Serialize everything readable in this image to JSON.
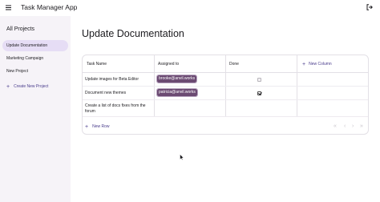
{
  "app": {
    "title": "Task Manager App",
    "menu_icon": "hamburger-menu-icon",
    "logout_icon": "logout-icon"
  },
  "sidebar": {
    "heading": "All Projects",
    "items": [
      {
        "label": "Update Documentation",
        "active": true
      },
      {
        "label": "Marketing Campaign",
        "active": false
      },
      {
        "label": "New Project",
        "active": false
      }
    ],
    "create_label": "Create New Project"
  },
  "main": {
    "title": "Update Documentation",
    "table": {
      "columns": [
        "Task Name",
        "Assigned to",
        "Done"
      ],
      "add_column_label": "New Column",
      "rows": [
        {
          "task": "Update images for Beta Editor",
          "assignee": "brooke@anvil.works",
          "done": false
        },
        {
          "task": "Document new themes",
          "assignee": "patricia@anvil.works",
          "done": true
        },
        {
          "task": "Create a list of docs fixes from the forum",
          "assignee": "",
          "done": false
        }
      ],
      "new_row_label": "New Row"
    }
  },
  "colors": {
    "accent": "#4a3c8c",
    "chip": "#6b4a72",
    "active_nav": "#e6ddf5",
    "sidebar_bg": "#f6f3f8"
  }
}
